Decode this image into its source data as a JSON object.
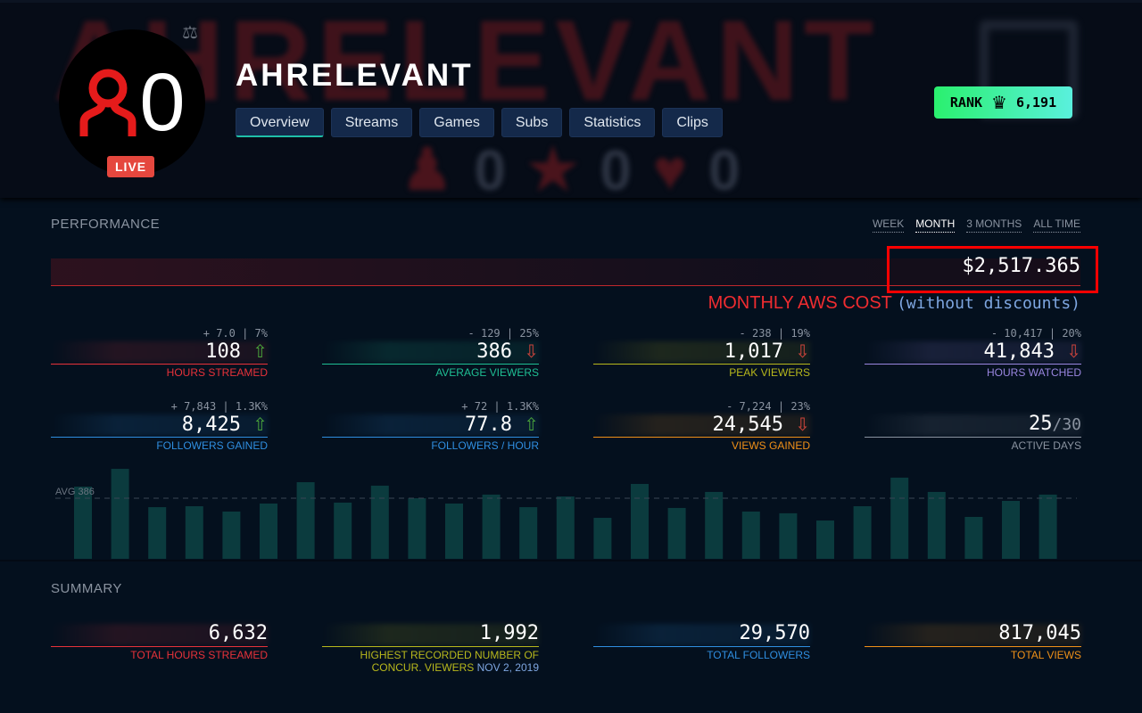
{
  "channel": {
    "name": "AHRELEVANT",
    "avatar_count": "0",
    "live_label": "LIVE",
    "watermark_counts": [
      "0",
      "0",
      "0"
    ],
    "tabs": [
      "Overview",
      "Streams",
      "Games",
      "Subs",
      "Statistics",
      "Clips"
    ],
    "active_tab": "Overview",
    "rank": {
      "label": "RANK",
      "value": "6,191",
      "icon": "crown-icon"
    }
  },
  "performance": {
    "title": "PERFORMANCE",
    "periods": [
      "WEEK",
      "MONTH",
      "3 MONTHS",
      "ALL TIME"
    ],
    "active_period": "MONTH",
    "cost_value": "$2,517.365",
    "cost_label": "MONTHLY AWS COST",
    "cost_note": "(without discounts)",
    "cards": [
      {
        "delta": "+ 7.0 | 7%",
        "value": "108",
        "trend": "up",
        "label": "HOURS STREAMED",
        "color": "#e8323a"
      },
      {
        "delta": "- 129 | 25%",
        "value": "386",
        "trend": "down",
        "label": "AVERAGE VIEWERS",
        "color": "#1fbf94"
      },
      {
        "delta": "- 238 | 19%",
        "value": "1,017",
        "trend": "down",
        "label": "PEAK VIEWERS",
        "color": "#b8b81c"
      },
      {
        "delta": "- 10,417 | 20%",
        "value": "41,843",
        "trend": "down",
        "label": "HOURS WATCHED",
        "color": "#9a86e0"
      },
      {
        "delta": "+ 7,843 | 1.3K%",
        "value": "8,425",
        "trend": "up",
        "label": "FOLLOWERS GAINED",
        "color": "#2f8ee0"
      },
      {
        "delta": "+ 72 | 1.3K%",
        "value": "77.8",
        "trend": "up",
        "label": "FOLLOWERS / HOUR",
        "color": "#2f8ee0"
      },
      {
        "delta": "- 7,224 | 23%",
        "value": "24,545",
        "trend": "down",
        "label": "VIEWS GAINED",
        "color": "#f09018"
      },
      {
        "delta": "",
        "value": "25",
        "value_suffix": "/30",
        "trend": "",
        "label": "ACTIVE DAYS",
        "color": "#8a93a0"
      }
    ]
  },
  "chart_data": {
    "type": "bar",
    "avg_label": "AVG 386",
    "avg": 386,
    "values": [
      460,
      573,
      329,
      335,
      301,
      352,
      488,
      358,
      466,
      386,
      352,
      409,
      329,
      397,
      261,
      477,
      324,
      426,
      301,
      290,
      244,
      335,
      517,
      426,
      267,
      369,
      409
    ],
    "bar_color": "#0b3b3e",
    "grid": false
  },
  "summary": {
    "title": "SUMMARY",
    "cards": [
      {
        "value": "6,632",
        "label": "TOTAL HOURS STREAMED",
        "color": "#e8323a"
      },
      {
        "value": "1,992",
        "label": "HIGHEST RECORDED NUMBER OF CONCUR. VIEWERS",
        "date": "NOV 2, 2019",
        "color": "#b8b81c"
      },
      {
        "value": "29,570",
        "label": "TOTAL FOLLOWERS",
        "color": "#2f8ee0"
      },
      {
        "value": "817,045",
        "label": "TOTAL VIEWS",
        "color": "#f09018"
      }
    ]
  }
}
